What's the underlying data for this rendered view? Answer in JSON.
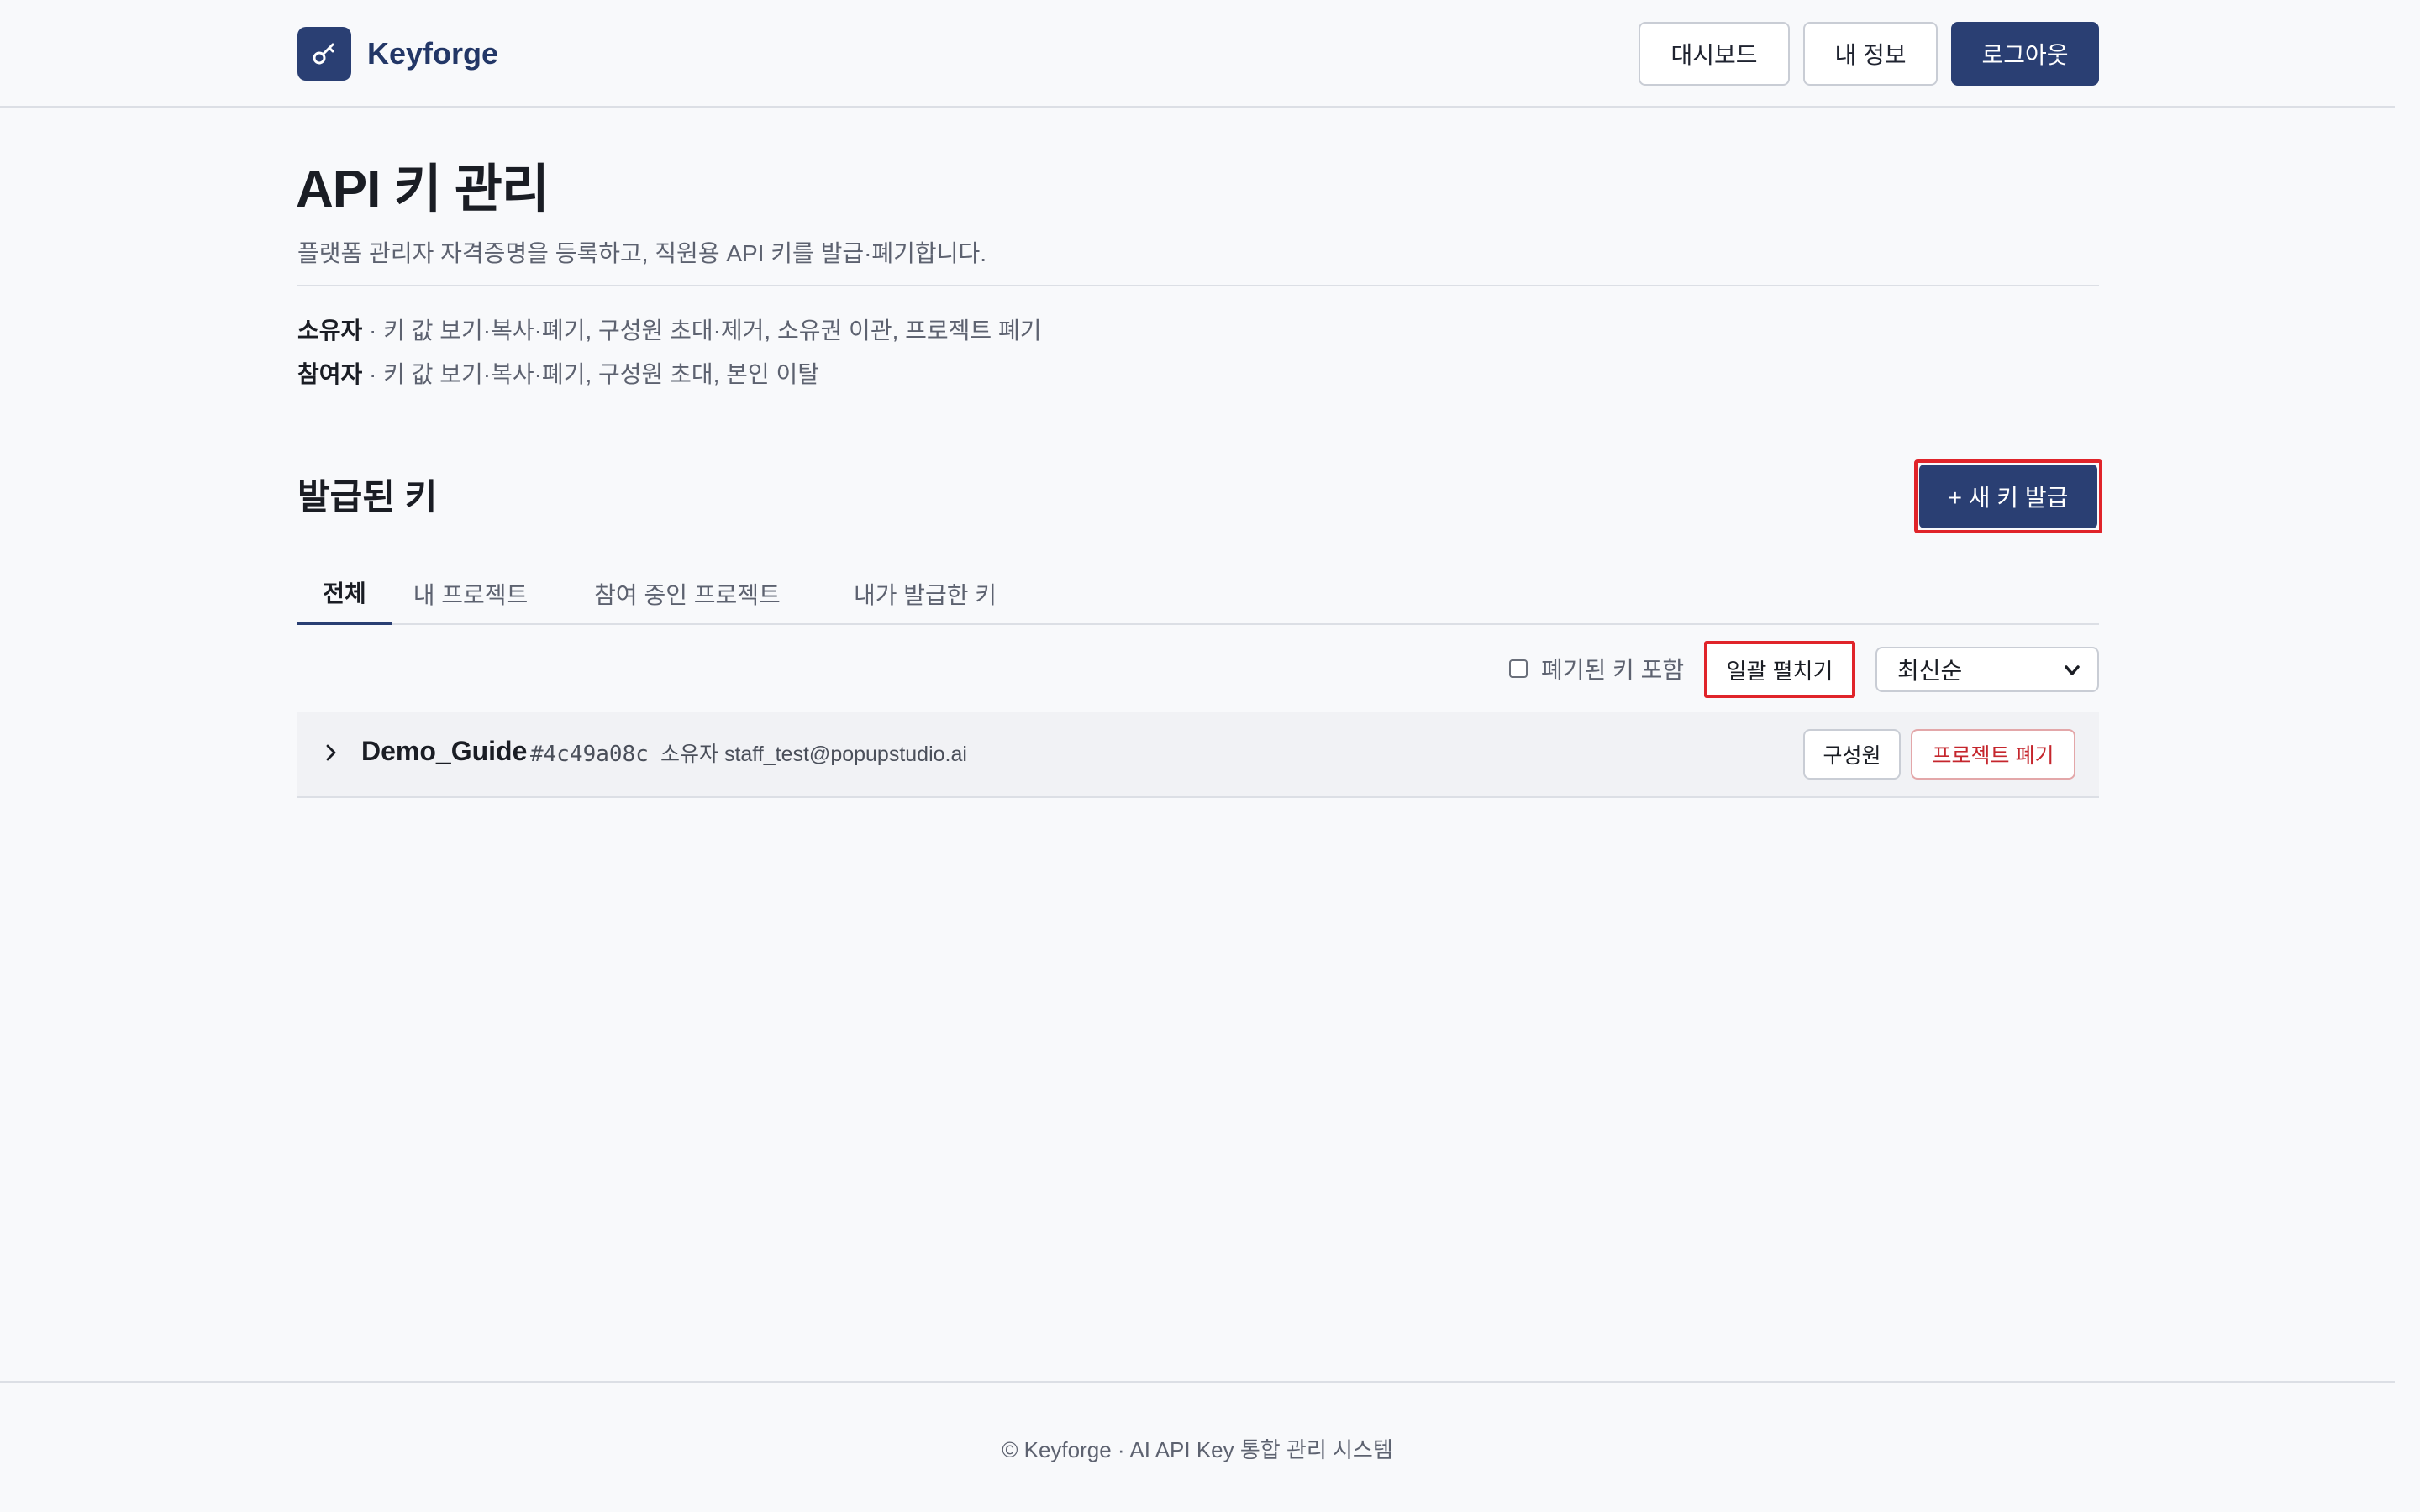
{
  "header": {
    "brand": "Keyforge",
    "logo_icon": "key-icon",
    "nav": {
      "dashboard": "대시보드",
      "my_info": "내 정보",
      "logout": "로그아웃"
    }
  },
  "page": {
    "title": "API 키 관리",
    "subtitle": "플랫폼 관리자 자격증명을 등록하고, 직원용 API 키를 발급·폐기합니다.",
    "roles": [
      {
        "name": "소유자",
        "desc": " · 키 값 보기·복사·폐기, 구성원 초대·제거, 소유권 이관, 프로젝트 폐기"
      },
      {
        "name": "참여자",
        "desc": " · 키 값 보기·복사·폐기, 구성원 초대, 본인 이탈"
      }
    ]
  },
  "keys": {
    "section_title": "발급된 키",
    "new_key_label": "+ 새 키 발급",
    "tabs": [
      {
        "label": "전체",
        "active": true
      },
      {
        "label": "내 프로젝트",
        "active": false
      },
      {
        "label": "참여 중인 프로젝트",
        "active": false
      },
      {
        "label": "내가 발급한 키",
        "active": false
      }
    ],
    "include_revoked_label": "폐기된 키 포함",
    "expand_all_label": "일괄 펼치기",
    "sort_selected": "최신순",
    "projects": [
      {
        "name": "Demo_Guide",
        "id": "#4c49a08c",
        "owner": "소유자 staff_test@popupstudio.ai",
        "members_label": "구성원",
        "delete_label": "프로젝트 폐기"
      }
    ]
  },
  "footer": {
    "text": "© Keyforge · AI API Key 통합 관리 시스템"
  },
  "colors": {
    "primary": "#2a3f73",
    "danger": "#c5262d",
    "highlight": "#e0242a",
    "background": "#f8f9fb"
  }
}
